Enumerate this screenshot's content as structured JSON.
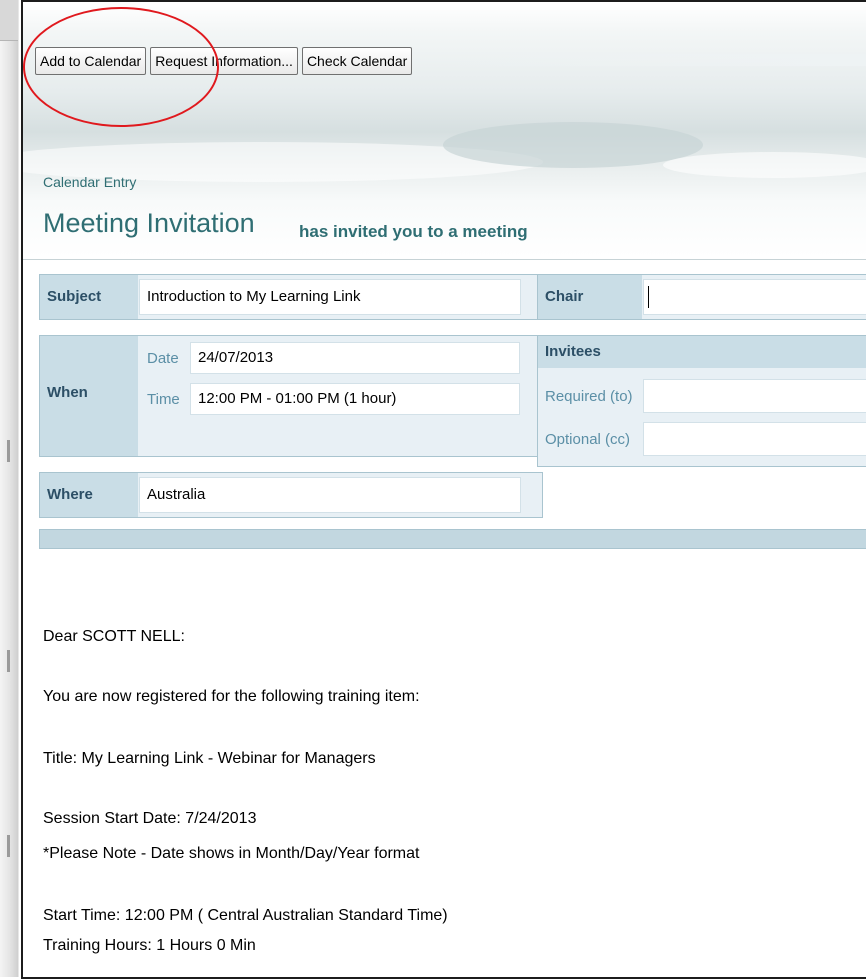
{
  "toolbar": {
    "add_to_calendar": "Add to Calendar",
    "request_information": "Request Information...",
    "check_calendar": "Check Calendar"
  },
  "header": {
    "label": "Calendar Entry",
    "title": "Meeting Invitation",
    "subtitle": "has invited you to a meeting"
  },
  "form": {
    "subject_label": "Subject",
    "subject_value": "Introduction to My Learning Link",
    "chair_label": "Chair",
    "chair_value": "",
    "when_label": "When",
    "date_label": "Date",
    "date_value": "24/07/2013",
    "time_label": "Time",
    "time_value": "12:00 PM - 01:00 PM   (1 hour)",
    "invitees_label": "Invitees",
    "required_label": "Required (to)",
    "required_value": "",
    "optional_label": "Optional (cc)",
    "optional_value": "",
    "where_label": "Where",
    "where_value": "Australia"
  },
  "body": {
    "greeting": "Dear SCOTT NELL:",
    "registered": "You are now registered for the following training item:",
    "title_line": "Title: My Learning Link - Webinar for Managers",
    "session_start": "Session Start Date: 7/24/2013",
    "note": "*Please Note - Date shows in Month/Day/Year format",
    "start_time": "Start Time: 12:00 PM ( Central Australian Standard Time)",
    "training_hours": "Training Hours: 1 Hours 0 Min"
  },
  "colors": {
    "accent_teal": "#2f6e73",
    "label_bg": "#c9dde6",
    "box_bg": "#e8f0f5",
    "annotation_red": "#e0191e"
  }
}
